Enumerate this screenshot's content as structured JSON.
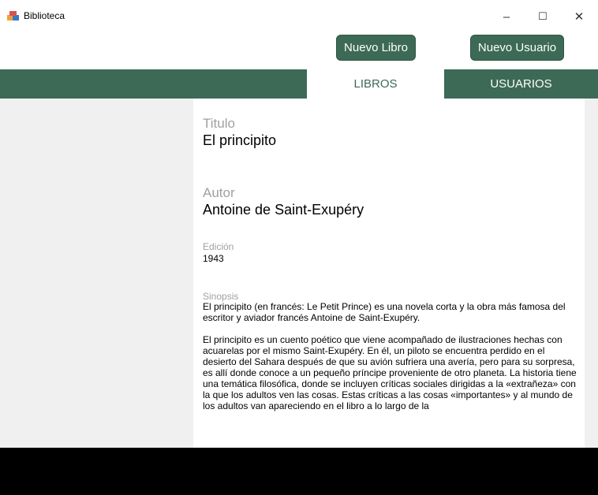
{
  "window": {
    "title": "Biblioteca",
    "minimize": "–",
    "maximize": "☐",
    "close": "✕"
  },
  "toolbar": {
    "new_book": "Nuevo Libro",
    "new_user": "Nuevo Usuario"
  },
  "tabs": [
    {
      "label": "LIBROS",
      "active": true
    },
    {
      "label": "USUARIOS",
      "active": false
    }
  ],
  "book": {
    "title_label": "Titulo",
    "title": "El principito",
    "author_label": "Autor",
    "author": "Antoine de Saint-Exupéry",
    "edition_label": "Edición",
    "edition": "1943",
    "synopsis_label": "Sinopsis",
    "synopsis_p1": "El principito (en francés: Le Petit Prince) es una novela corta y la obra más famosa del escritor y aviador francés Antoine de Saint-Exupéry.",
    "synopsis_p2": "El principito es un cuento poético que viene acompañado de ilustraciones hechas con acuarelas por el mismo Saint-Exupéry.  En él, un piloto se encuentra perdido en el desierto del Sahara después de que su avión sufriera una avería, pero para su sorpresa, es allí donde conoce a un pequeño príncipe proveniente de otro planeta. La historia tiene una temática filosófica, donde se incluyen críticas sociales dirigidas a la «extrañeza» con la que los adultos ven las cosas. Estas críticas a las cosas «importantes» y al mundo de los adultos van apareciendo en el libro a lo largo de la"
  },
  "colors": {
    "accent": "#3c6a56"
  }
}
